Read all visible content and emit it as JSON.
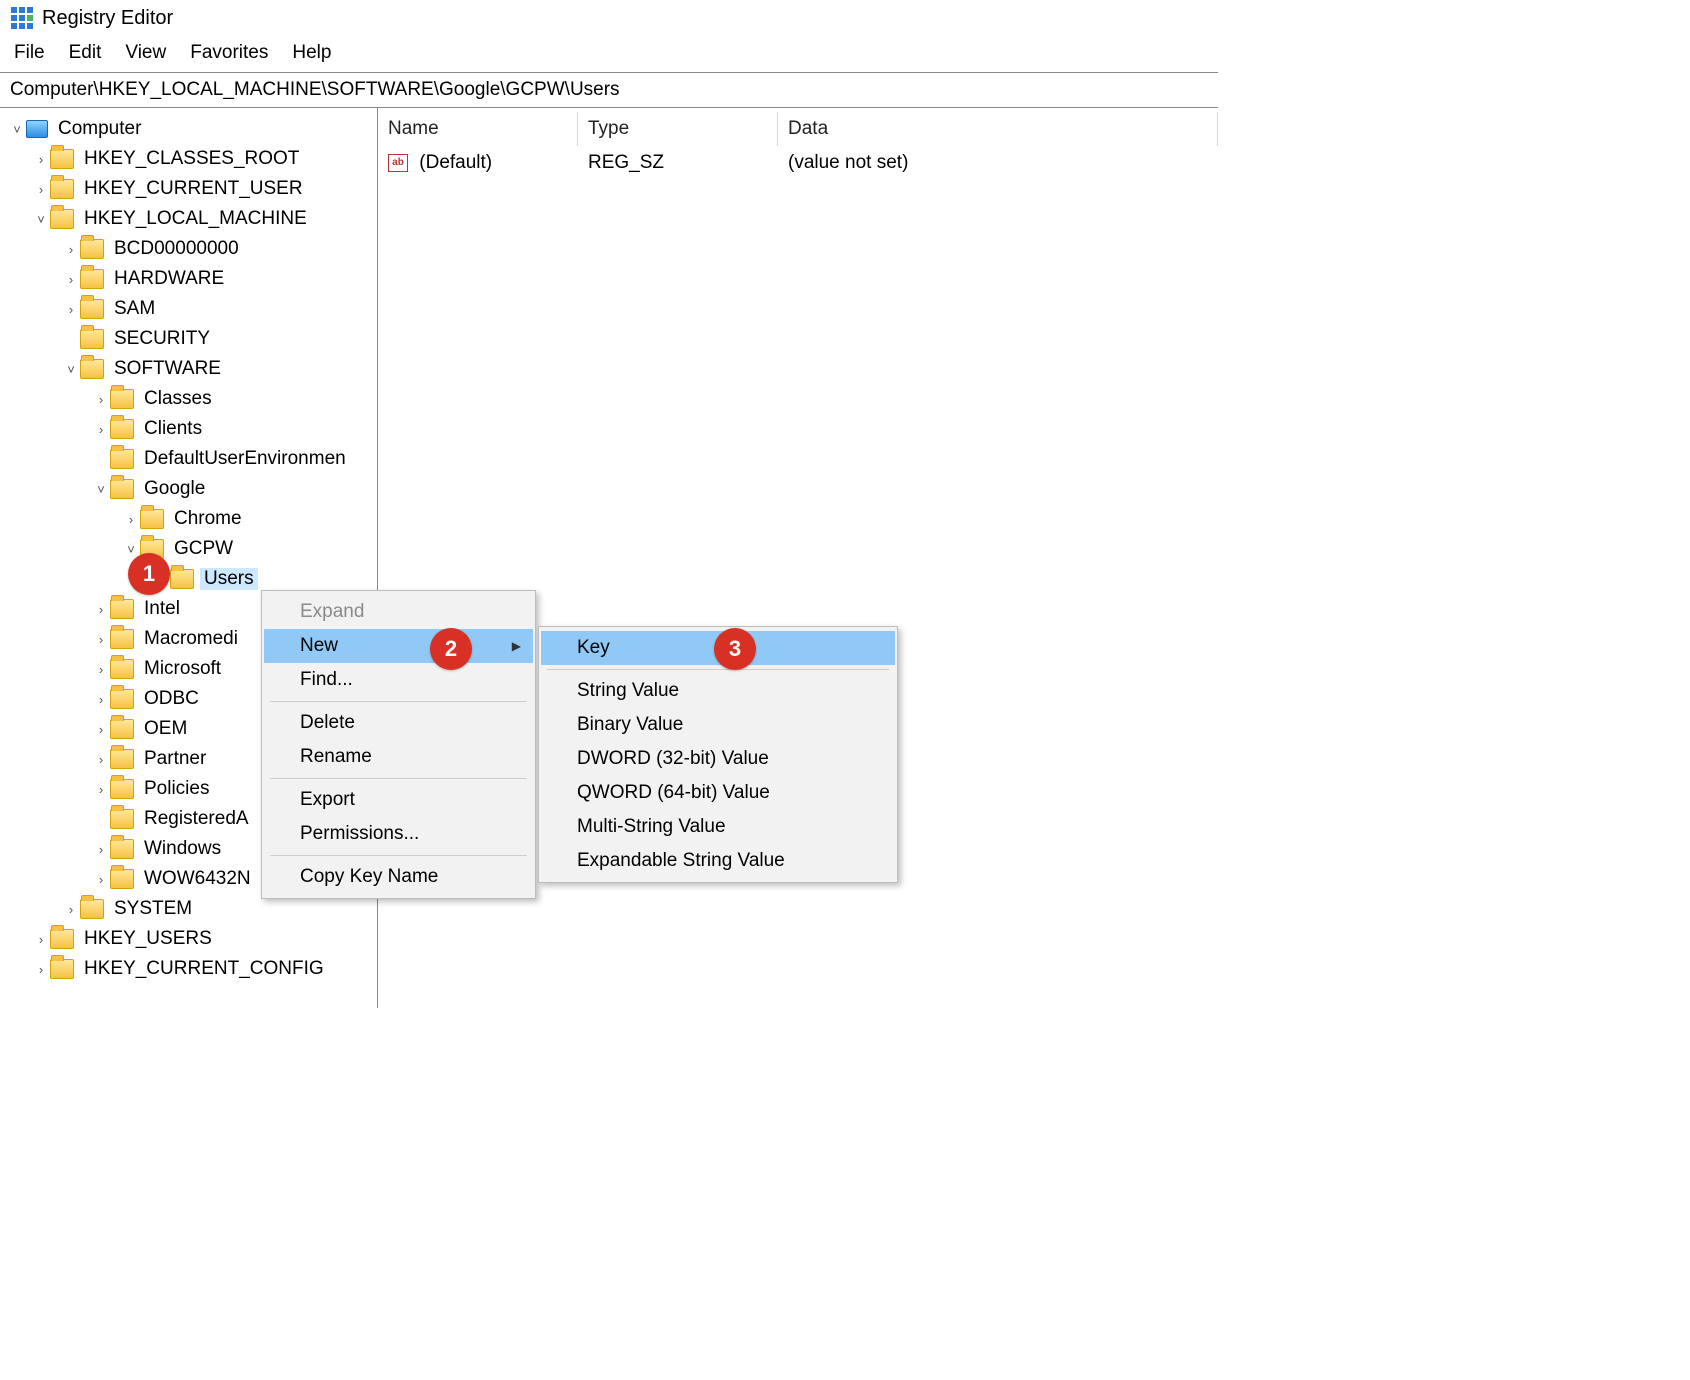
{
  "titlebar": {
    "title": "Registry Editor"
  },
  "menubar": [
    "File",
    "Edit",
    "View",
    "Favorites",
    "Help"
  ],
  "address": "Computer\\HKEY_LOCAL_MACHINE\\SOFTWARE\\Google\\GCPW\\Users",
  "tree": {
    "root": "Computer",
    "hives": {
      "hkcr": "HKEY_CLASSES_ROOT",
      "hkcu": "HKEY_CURRENT_USER",
      "hklm": "HKEY_LOCAL_MACHINE",
      "hku": "HKEY_USERS",
      "hkcc": "HKEY_CURRENT_CONFIG"
    },
    "hklm_children": [
      "BCD00000000",
      "HARDWARE",
      "SAM",
      "SECURITY",
      "SOFTWARE",
      "SYSTEM"
    ],
    "software_children": [
      "Classes",
      "Clients",
      "DefaultUserEnvironmen",
      "Google",
      "Intel",
      "Macromedi",
      "Microsoft",
      "ODBC",
      "OEM",
      "Partner",
      "Policies",
      "RegisteredA",
      "Windows",
      "WOW6432N"
    ],
    "google_children": [
      "Chrome",
      "GCPW"
    ],
    "gcpw_children": [
      "Users"
    ]
  },
  "list": {
    "headers": {
      "name": "Name",
      "type": "Type",
      "data": "Data"
    },
    "rows": [
      {
        "name": "(Default)",
        "type": "REG_SZ",
        "data": "(value not set)"
      }
    ]
  },
  "ctx1": {
    "expand": "Expand",
    "new": "New",
    "find": "Find...",
    "delete": "Delete",
    "rename": "Rename",
    "export": "Export",
    "permissions": "Permissions...",
    "copy": "Copy Key Name"
  },
  "ctx2": {
    "key": "Key",
    "string": "String Value",
    "binary": "Binary Value",
    "dword": "DWORD (32-bit) Value",
    "qword": "QWORD (64-bit) Value",
    "multi": "Multi-String Value",
    "expand": "Expandable String Value"
  },
  "badges": {
    "b1": "1",
    "b2": "2",
    "b3": "3"
  },
  "glyphs": {
    "down": "˅",
    "right": "›",
    "ab": "ab",
    "subarrow": "▶"
  }
}
